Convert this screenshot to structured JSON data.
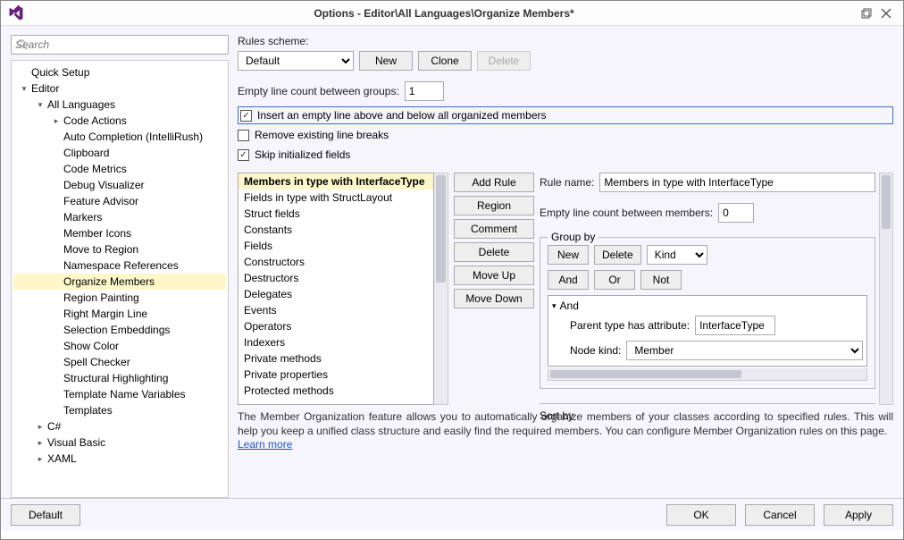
{
  "title": "Options - Editor\\All Languages\\Organize Members*",
  "search": {
    "placeholder": "Search"
  },
  "tree": {
    "items": [
      {
        "label": "Quick Setup",
        "depth": 0,
        "chev": ""
      },
      {
        "label": "Editor",
        "depth": 0,
        "chev": "open"
      },
      {
        "label": "All Languages",
        "depth": 1,
        "chev": "open"
      },
      {
        "label": "Code Actions",
        "depth": 2,
        "chev": "closed"
      },
      {
        "label": "Auto Completion (IntelliRush)",
        "depth": 2,
        "chev": ""
      },
      {
        "label": "Clipboard",
        "depth": 2,
        "chev": ""
      },
      {
        "label": "Code Metrics",
        "depth": 2,
        "chev": ""
      },
      {
        "label": "Debug Visualizer",
        "depth": 2,
        "chev": ""
      },
      {
        "label": "Feature Advisor",
        "depth": 2,
        "chev": ""
      },
      {
        "label": "Markers",
        "depth": 2,
        "chev": ""
      },
      {
        "label": "Member Icons",
        "depth": 2,
        "chev": ""
      },
      {
        "label": "Move to Region",
        "depth": 2,
        "chev": ""
      },
      {
        "label": "Namespace References",
        "depth": 2,
        "chev": ""
      },
      {
        "label": "Organize Members",
        "depth": 2,
        "chev": "",
        "selected": true
      },
      {
        "label": "Region Painting",
        "depth": 2,
        "chev": ""
      },
      {
        "label": "Right Margin Line",
        "depth": 2,
        "chev": ""
      },
      {
        "label": "Selection Embeddings",
        "depth": 2,
        "chev": ""
      },
      {
        "label": "Show Color",
        "depth": 2,
        "chev": ""
      },
      {
        "label": "Spell Checker",
        "depth": 2,
        "chev": ""
      },
      {
        "label": "Structural Highlighting",
        "depth": 2,
        "chev": ""
      },
      {
        "label": "Template Name Variables",
        "depth": 2,
        "chev": ""
      },
      {
        "label": "Templates",
        "depth": 2,
        "chev": ""
      },
      {
        "label": "C#",
        "depth": 1,
        "chev": "closed"
      },
      {
        "label": "Visual Basic",
        "depth": 1,
        "chev": "closed"
      },
      {
        "label": "XAML",
        "depth": 1,
        "chev": "closed"
      }
    ]
  },
  "rules_scheme": {
    "label": "Rules scheme:",
    "value": "Default",
    "new_label": "New",
    "clone_label": "Clone",
    "delete_label": "Delete"
  },
  "empty_line_groups": {
    "label": "Empty line count between groups:",
    "value": "1"
  },
  "chk_insert": {
    "label": "Insert an empty line above and below all organized members",
    "checked": true
  },
  "chk_remove": {
    "label": "Remove existing line breaks",
    "checked": false
  },
  "chk_skip": {
    "label": "Skip initialized fields",
    "checked": true
  },
  "rules_list": [
    "Members in type with InterfaceType",
    "Fields in type with StructLayout",
    "Struct fields",
    "Constants",
    "Fields",
    "Constructors",
    "Destructors",
    "Delegates",
    "Events",
    "Operators",
    "Indexers",
    "Private methods",
    "Private properties",
    "Protected methods"
  ],
  "rules_selected_index": 0,
  "rules_buttons": {
    "add": "Add Rule",
    "region": "Region",
    "comment": "Comment",
    "delete": "Delete",
    "moveup": "Move Up",
    "movedown": "Move Down"
  },
  "rule_detail": {
    "rule_name_label": "Rule name:",
    "rule_name_value": "Members in type with InterfaceType",
    "empty_line_members_label": "Empty line count between members:",
    "empty_line_members_value": "0",
    "groupby": {
      "title": "Group by",
      "new": "New",
      "delete": "Delete",
      "kind": "Kind",
      "and": "And",
      "or": "Or",
      "not": "Not",
      "tree_root": "And",
      "parent_attr_label": "Parent type has attribute:",
      "parent_attr_value": "InterfaceType",
      "node_kind_label": "Node kind:",
      "node_kind_value": "Member"
    },
    "sortby": {
      "title": "Sort by"
    }
  },
  "description": {
    "text": "The Member Organization feature allows you to automatically organize members of your classes according to specified rules. This will help you keep a unified class structure and easily find the required members. You can configure Member Organization rules on this page.",
    "learn_more": "Learn more"
  },
  "footer": {
    "default": "Default",
    "ok": "OK",
    "cancel": "Cancel",
    "apply": "Apply"
  }
}
